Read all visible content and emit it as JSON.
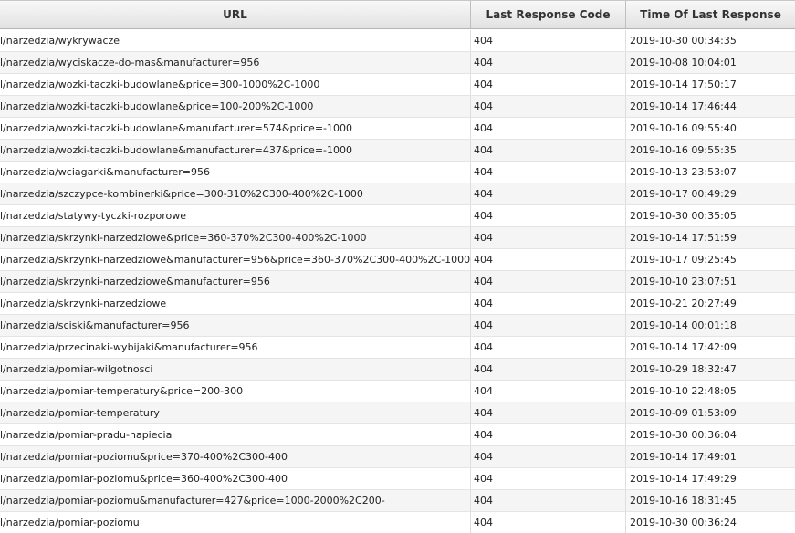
{
  "table": {
    "columns": [
      "URL",
      "Last Response Code",
      "Time Of Last Response"
    ],
    "rows": [
      {
        "url": "l/narzedzia/wykrywacze",
        "code": "404",
        "time": "2019-10-30 00:34:35"
      },
      {
        "url": "l/narzedzia/wyciskacze-do-mas&manufacturer=956",
        "code": "404",
        "time": "2019-10-08 10:04:01"
      },
      {
        "url": "l/narzedzia/wozki-taczki-budowlane&price=300-1000%2C-1000",
        "code": "404",
        "time": "2019-10-14 17:50:17"
      },
      {
        "url": "l/narzedzia/wozki-taczki-budowlane&price=100-200%2C-1000",
        "code": "404",
        "time": "2019-10-14 17:46:44"
      },
      {
        "url": "l/narzedzia/wozki-taczki-budowlane&manufacturer=574&price=-1000",
        "code": "404",
        "time": "2019-10-16 09:55:40"
      },
      {
        "url": "l/narzedzia/wozki-taczki-budowlane&manufacturer=437&price=-1000",
        "code": "404",
        "time": "2019-10-16 09:55:35"
      },
      {
        "url": "l/narzedzia/wciagarki&manufacturer=956",
        "code": "404",
        "time": "2019-10-13 23:53:07"
      },
      {
        "url": "l/narzedzia/szczypce-kombinerki&price=300-310%2C300-400%2C-1000",
        "code": "404",
        "time": "2019-10-17 00:49:29"
      },
      {
        "url": "l/narzedzia/statywy-tyczki-rozporowe",
        "code": "404",
        "time": "2019-10-30 00:35:05"
      },
      {
        "url": "l/narzedzia/skrzynki-narzedziowe&price=360-370%2C300-400%2C-1000",
        "code": "404",
        "time": "2019-10-14 17:51:59"
      },
      {
        "url": "l/narzedzia/skrzynki-narzedziowe&manufacturer=956&price=360-370%2C300-400%2C-1000",
        "code": "404",
        "time": "2019-10-17 09:25:45"
      },
      {
        "url": "l/narzedzia/skrzynki-narzedziowe&manufacturer=956",
        "code": "404",
        "time": "2019-10-10 23:07:51"
      },
      {
        "url": "l/narzedzia/skrzynki-narzedziowe",
        "code": "404",
        "time": "2019-10-21 20:27:49"
      },
      {
        "url": "l/narzedzia/sciski&manufacturer=956",
        "code": "404",
        "time": "2019-10-14 00:01:18"
      },
      {
        "url": "l/narzedzia/przecinaki-wybijaki&manufacturer=956",
        "code": "404",
        "time": "2019-10-14 17:42:09"
      },
      {
        "url": "l/narzedzia/pomiar-wilgotnosci",
        "code": "404",
        "time": "2019-10-29 18:32:47"
      },
      {
        "url": "l/narzedzia/pomiar-temperatury&price=200-300",
        "code": "404",
        "time": "2019-10-10 22:48:05"
      },
      {
        "url": "l/narzedzia/pomiar-temperatury",
        "code": "404",
        "time": "2019-10-09 01:53:09"
      },
      {
        "url": "l/narzedzia/pomiar-pradu-napiecia",
        "code": "404",
        "time": "2019-10-30 00:36:04"
      },
      {
        "url": "l/narzedzia/pomiar-poziomu&price=370-400%2C300-400",
        "code": "404",
        "time": "2019-10-14 17:49:01"
      },
      {
        "url": "l/narzedzia/pomiar-poziomu&price=360-400%2C300-400",
        "code": "404",
        "time": "2019-10-14 17:49:29"
      },
      {
        "url": "l/narzedzia/pomiar-poziomu&manufacturer=427&price=1000-2000%2C200-",
        "code": "404",
        "time": "2019-10-16 18:31:45"
      },
      {
        "url": "l/narzedzia/pomiar-poziomu",
        "code": "404",
        "time": "2019-10-30 00:36:24"
      }
    ]
  }
}
